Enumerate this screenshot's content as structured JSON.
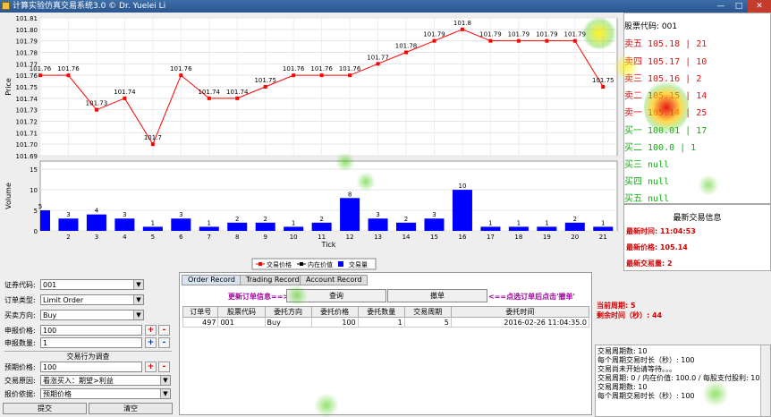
{
  "title": "计算实验仿真交易系统3.0 © Dr. Yuelei Li",
  "window_controls": [
    "—",
    "□",
    "✕"
  ],
  "chart_data": [
    {
      "type": "line",
      "ylabel": "Price",
      "x": [
        "1",
        "2",
        "3",
        "4",
        "5",
        "6",
        "7",
        "8",
        "9",
        "10",
        "11",
        "12",
        "13",
        "14",
        "15",
        "16",
        "17",
        "18",
        "19",
        "20",
        "21"
      ],
      "series": [
        {
          "name": "交易价格",
          "values": [
            101.76,
            101.76,
            101.73,
            101.74,
            101.7,
            101.76,
            101.74,
            101.74,
            101.75,
            101.76,
            101.76,
            101.76,
            101.77,
            101.78,
            101.79,
            101.8,
            101.79,
            101.79,
            101.79,
            101.79,
            101.75
          ]
        }
      ],
      "data_labels": [
        "101.76",
        "101.76",
        "101.73",
        "101.74",
        "101.7",
        "101.76",
        "101.74",
        "101.74",
        "101.75",
        "101.76",
        "101.76",
        "101.76",
        "101.77",
        "101.78",
        "101.79",
        "101.8",
        "101.79",
        "101.79",
        "101.79",
        "101.79",
        "101.75"
      ],
      "yticks": [
        "101.69",
        "101.70",
        "101.71",
        "101.72",
        "101.73",
        "101.74",
        "101.75",
        "101.76",
        "101.77",
        "101.78",
        "101.79",
        "101.80",
        "101.81"
      ],
      "ylim": [
        101.69,
        101.81
      ]
    },
    {
      "type": "bar",
      "ylabel": "Volume",
      "xlabel": "Tick",
      "categories": [
        "1",
        "2",
        "3",
        "4",
        "5",
        "6",
        "7",
        "8",
        "9",
        "10",
        "11",
        "12",
        "13",
        "14",
        "15",
        "16",
        "17",
        "18",
        "19",
        "20",
        "21"
      ],
      "values": [
        5,
        3,
        4,
        3,
        1,
        3,
        1,
        2,
        2,
        1,
        2,
        8,
        3,
        2,
        3,
        10,
        1,
        1,
        1,
        2,
        1
      ],
      "xticks": [
        "2",
        "3",
        "4",
        "5",
        "6",
        "7",
        "8",
        "9",
        "10",
        "11",
        "12",
        "13",
        "14",
        "15",
        "16",
        "17",
        "18",
        "19",
        "20",
        "21"
      ],
      "yticks": [
        "0",
        "5",
        "10",
        "15"
      ],
      "ylim": [
        0,
        17
      ]
    }
  ],
  "legend": [
    "交易价格",
    "内在价值",
    "交易量"
  ],
  "colors": {
    "price": "#ff0000",
    "volume": "#0000ff",
    "sell": "#e01010",
    "buy": "#10b010"
  },
  "quotes": {
    "code_label": "股票代码: 001",
    "sells": [
      "卖五 105.18 | 21",
      "卖四 105.17 | 10",
      "卖三 105.16 | 2",
      "卖二 105.15 | 14",
      "卖一 105.14 | 25"
    ],
    "buys": [
      "买一 100.01 | 17",
      "买二 100.0 | 1",
      "买三 null",
      "买四 null",
      "买五 null"
    ]
  },
  "latest": {
    "title": "最新交易信息",
    "time": "最新时间: 11:04:53",
    "price": "最新价格: 105.14",
    "volume": "最新交易量: 2"
  },
  "form": {
    "stock_label": "证券代码:",
    "stock_value": "001",
    "type_label": "订单类型:",
    "type_value": "Limit Order",
    "dir_label": "买卖方向:",
    "dir_value": "Buy",
    "price_label": "申报价格:",
    "price_value": "100",
    "qty_label": "申报数量:",
    "qty_value": "1",
    "plus": "+",
    "minus": "-",
    "plus2": "+",
    "minus2": "-",
    "group_title": "交易行为调查",
    "expect_label": "预期价格:",
    "expect_value": "100",
    "reason_label": "交易原因:",
    "reason_value": "看涨买入：期望>利益",
    "basis_label": "报价依据:",
    "basis_value": "预期价格",
    "submit": "提交",
    "clear": "清空",
    "plus3": "+",
    "minus3": "-"
  },
  "orders": {
    "tabs": [
      "Order Record",
      "Trading Record",
      "Account Record"
    ],
    "refresh_hint": "更新订单信息==>",
    "query": "查询",
    "cancel": "撤单",
    "cancel_hint": "<==点选订单后点击'撤单'",
    "columns": [
      "订单号",
      "股票代码",
      "委托方向",
      "委托价格",
      "委托数量",
      "交易周期",
      "委托时间"
    ],
    "rows": [
      [
        "497",
        "001",
        "Buy",
        "100",
        "1",
        "5",
        "2016-02-26 11:04:35.0"
      ]
    ]
  },
  "status": {
    "period": "当前周期: 5",
    "remaining": "剩余时间（秒）: 44"
  },
  "log": [
    "交易周期数: 10",
    "每个周期交易时长（秒）: 100",
    "交易尚未开始请等待。。。",
    "交易周期: 0 / 内在价值: 100.0 / 每股支付股利: 10.0",
    "交易周期数: 10",
    "每个周期交易时长（秒）: 100"
  ]
}
